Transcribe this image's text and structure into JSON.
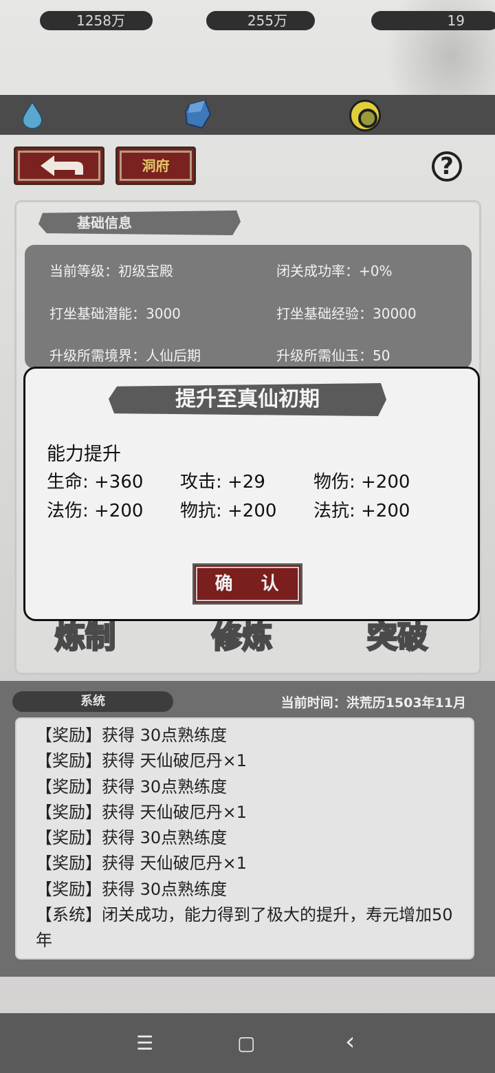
{
  "resources": {
    "water": "1258万",
    "crystal": "255万",
    "coin": "19"
  },
  "top_buttons": {
    "home_label": "洞府",
    "help_symbol": "?"
  },
  "panel": {
    "title": "基础信息",
    "info": {
      "level": "当前等级：初级宝殿",
      "success_rate": "闭关成功率：+0%",
      "base_potential": "打坐基础潜能：3000",
      "base_exp": "打坐基础经验：30000",
      "required_realm": "升级所需境界：人仙后期",
      "required_jade": "升级所需仙玉：50"
    },
    "actions": [
      "炼制",
      "修炼",
      "突破"
    ]
  },
  "modal": {
    "title": "提升至真仙初期",
    "heading": "能力提升",
    "stats": [
      "生命: +360",
      "攻击: +29",
      "物伤: +200",
      "法伤: +200",
      "物抗: +200",
      "法抗: +200"
    ],
    "confirm_label": "确 认"
  },
  "log": {
    "tab_label": "系统",
    "current_time": "当前时间：洪荒历1503年11月",
    "lines": [
      "【奖励】获得 30点熟练度",
      "【奖励】获得 天仙破厄丹×1",
      "【奖励】获得 30点熟练度",
      "【奖励】获得 天仙破厄丹×1",
      "【奖励】获得 30点熟练度",
      "【奖励】获得 天仙破厄丹×1",
      "【奖励】获得 30点熟练度",
      "【系统】闭关成功，能力得到了极大的提升，寿元增加50年"
    ]
  },
  "navbar": {
    "menu_icon": "☰",
    "home_icon": "▢",
    "back_icon": "‹"
  }
}
